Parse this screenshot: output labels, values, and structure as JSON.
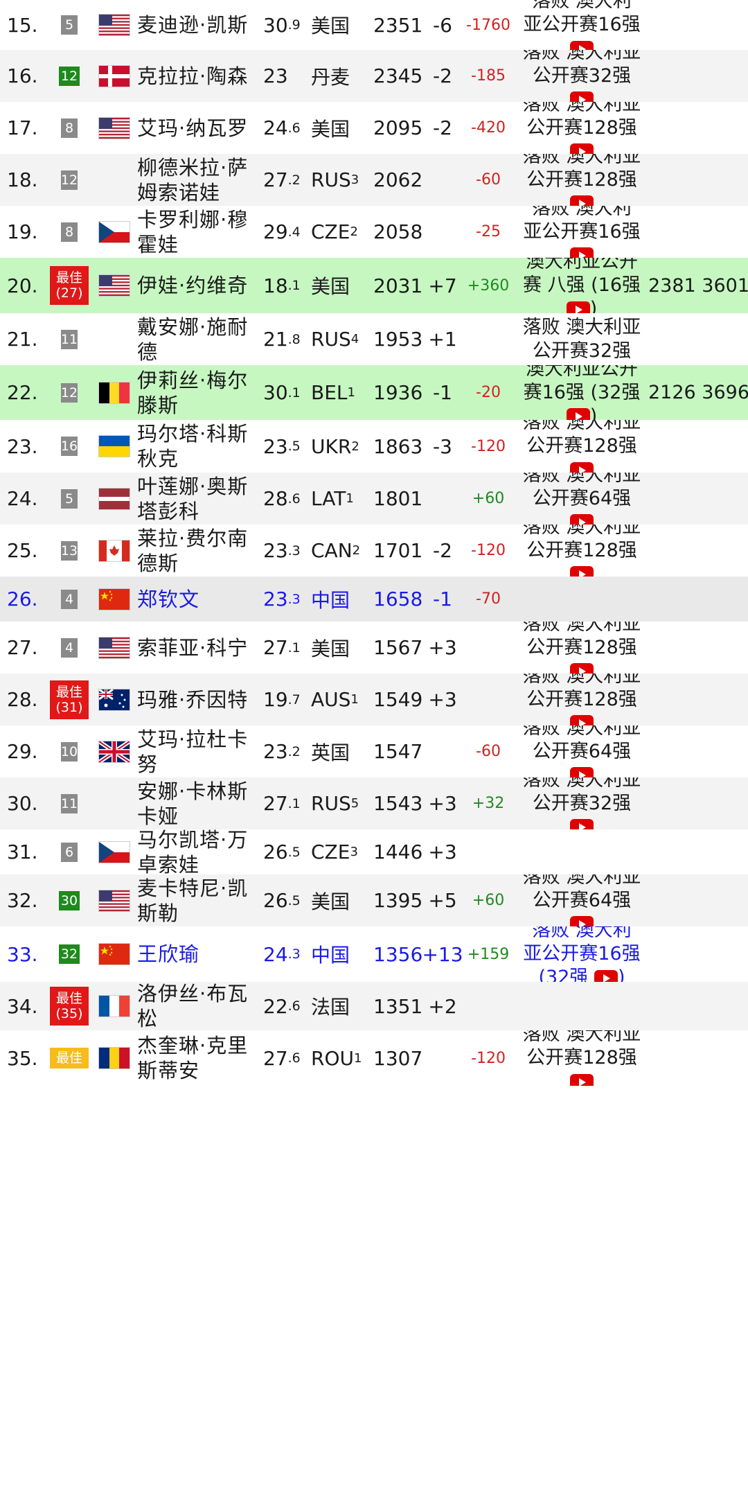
{
  "rows": [
    {
      "rank": "15.",
      "badge": "5",
      "badge_type": "gray",
      "flag": "us",
      "name": "麦迪逊·凯斯",
      "age": "30",
      "age_dec": ".9",
      "country": "美国",
      "country_sub": "",
      "points": "2351",
      "move": "-6",
      "delta": "-1760",
      "delta_type": "neg",
      "result": [
        "落败 澳大利",
        "亚公开赛16强"
      ],
      "yt": true,
      "extra": "",
      "bg": "white"
    },
    {
      "rank": "16.",
      "badge": "12",
      "badge_type": "green",
      "flag": "dk",
      "name": "克拉拉·陶森",
      "age": "23",
      "age_dec": "",
      "country": "丹麦",
      "country_sub": "",
      "points": "2345",
      "move": "-2",
      "delta": "-185",
      "delta_type": "neg",
      "result": [
        "落败 澳大利亚",
        "公开赛32强"
      ],
      "yt": true,
      "extra": "",
      "bg": "gray"
    },
    {
      "rank": "17.",
      "badge": "8",
      "badge_type": "gray",
      "flag": "us",
      "name": "艾玛·纳瓦罗",
      "age": "24",
      "age_dec": ".6",
      "country": "美国",
      "country_sub": "",
      "points": "2095",
      "move": "-2",
      "delta": "-420",
      "delta_type": "neg",
      "result": [
        "落败 澳大利亚",
        "公开赛128强"
      ],
      "yt": true,
      "extra": "",
      "bg": "white"
    },
    {
      "rank": "18.",
      "badge": "12",
      "badge_type": "gray",
      "flag": "",
      "name": "柳德米拉·萨姆索诺娃",
      "age": "27",
      "age_dec": ".2",
      "country": "RUS",
      "country_sub": "3",
      "points": "2062",
      "move": "",
      "delta": "-60",
      "delta_type": "neg",
      "result": [
        "落败 澳大利亚",
        "公开赛128强"
      ],
      "yt": true,
      "extra": "",
      "bg": "gray"
    },
    {
      "rank": "19.",
      "badge": "8",
      "badge_type": "gray",
      "flag": "cz",
      "name": "卡罗利娜·穆霍娃",
      "age": "29",
      "age_dec": ".4",
      "country": "CZE",
      "country_sub": "2",
      "points": "2058",
      "move": "",
      "delta": "-25",
      "delta_type": "neg",
      "result": [
        "落败 澳大利",
        "亚公开赛16强"
      ],
      "yt": true,
      "extra": "",
      "bg": "white"
    },
    {
      "rank": "20.",
      "badge": "最佳\n(27)",
      "badge_type": "red",
      "flag": "us",
      "name": "伊娃·约维奇",
      "age": "18",
      "age_dec": ".1",
      "country": "美国",
      "country_sub": "",
      "points": "2031",
      "move": "+7",
      "delta": "+360",
      "delta_type": "pos",
      "result": [
        "澳大利亚公开",
        "赛 八强 (16强",
        ")"
      ],
      "yt": true,
      "extra": "2381 3601",
      "bg": "green"
    },
    {
      "rank": "21.",
      "badge": "11",
      "badge_type": "gray",
      "flag": "",
      "name": "戴安娜·施耐德",
      "age": "21",
      "age_dec": ".8",
      "country": "RUS",
      "country_sub": "4",
      "points": "1953",
      "move": "+1",
      "delta": "",
      "delta_type": "neg",
      "result": [
        "落败 澳大利亚",
        "公开赛32强"
      ],
      "yt": false,
      "extra": "",
      "bg": "white"
    },
    {
      "rank": "22.",
      "badge": "12",
      "badge_type": "gray",
      "flag": "be",
      "name": "伊莉丝·梅尔滕斯",
      "age": "30",
      "age_dec": ".1",
      "country": "BEL",
      "country_sub": "1",
      "points": "1936",
      "move": "-1",
      "delta": "-20",
      "delta_type": "neg",
      "result": [
        "澳大利亚公开",
        "赛16强 (32强",
        ")"
      ],
      "yt": true,
      "extra": "2126 3696",
      "bg": "green"
    },
    {
      "rank": "23.",
      "badge": "16",
      "badge_type": "gray",
      "flag": "ua",
      "name": "玛尔塔·科斯秋克",
      "age": "23",
      "age_dec": ".5",
      "country": "UKR",
      "country_sub": "2",
      "points": "1863",
      "move": "-3",
      "delta": "-120",
      "delta_type": "neg",
      "result": [
        "落败 澳大利亚",
        "公开赛128强"
      ],
      "yt": true,
      "extra": "",
      "bg": "white"
    },
    {
      "rank": "24.",
      "badge": "5",
      "badge_type": "gray",
      "flag": "lv",
      "name": "叶莲娜·奥斯塔彭科",
      "age": "28",
      "age_dec": ".6",
      "country": "LAT",
      "country_sub": "1",
      "points": "1801",
      "move": "",
      "delta": "+60",
      "delta_type": "pos",
      "result": [
        "落败 澳大利亚",
        "公开赛64强"
      ],
      "yt": true,
      "extra": "",
      "bg": "gray"
    },
    {
      "rank": "25.",
      "badge": "13",
      "badge_type": "gray",
      "flag": "ca",
      "name": "莱拉·费尔南德斯",
      "age": "23",
      "age_dec": ".3",
      "country": "CAN",
      "country_sub": "2",
      "points": "1701",
      "move": "-2",
      "delta": "-120",
      "delta_type": "neg",
      "result": [
        "落败 澳大利亚",
        "公开赛128强"
      ],
      "yt": true,
      "extra": "",
      "bg": "white"
    },
    {
      "rank": "26.",
      "badge": "4",
      "badge_type": "gray",
      "flag": "cn",
      "name": "郑钦文",
      "age": "23",
      "age_dec": ".3",
      "country": "中国",
      "country_sub": "",
      "points": "1658",
      "move": "-1",
      "delta": "-70",
      "delta_type": "neg",
      "result": [],
      "yt": false,
      "extra": "",
      "bg": "gray2",
      "highlight": true
    },
    {
      "rank": "27.",
      "badge": "4",
      "badge_type": "gray",
      "flag": "us",
      "name": "索菲亚·科宁",
      "age": "27",
      "age_dec": ".1",
      "country": "美国",
      "country_sub": "",
      "points": "1567",
      "move": "+3",
      "delta": "",
      "delta_type": "neg",
      "result": [
        "落败 澳大利亚",
        "公开赛128强"
      ],
      "yt": true,
      "extra": "",
      "bg": "white"
    },
    {
      "rank": "28.",
      "badge": "最佳\n(31)",
      "badge_type": "red",
      "flag": "au",
      "name": "玛雅·乔因特",
      "age": "19",
      "age_dec": ".7",
      "country": "AUS",
      "country_sub": "1",
      "points": "1549",
      "move": "+3",
      "delta": "",
      "delta_type": "neg",
      "result": [
        "落败 澳大利亚",
        "公开赛128强"
      ],
      "yt": true,
      "extra": "",
      "bg": "gray"
    },
    {
      "rank": "29.",
      "badge": "10",
      "badge_type": "gray",
      "flag": "gb",
      "name": "艾玛·拉杜卡努",
      "age": "23",
      "age_dec": ".2",
      "country": "英国",
      "country_sub": "",
      "points": "1547",
      "move": "",
      "delta": "-60",
      "delta_type": "neg",
      "result": [
        "落败 澳大利亚",
        "公开赛64强"
      ],
      "yt": true,
      "extra": "",
      "bg": "white"
    },
    {
      "rank": "30.",
      "badge": "11",
      "badge_type": "gray",
      "flag": "",
      "name": "安娜·卡林斯卡娅",
      "age": "27",
      "age_dec": ".1",
      "country": "RUS",
      "country_sub": "5",
      "points": "1543",
      "move": "+3",
      "delta": "+32",
      "delta_type": "pos",
      "result": [
        "落败 澳大利亚",
        "公开赛32强"
      ],
      "yt": true,
      "extra": "",
      "bg": "gray"
    },
    {
      "rank": "31.",
      "badge": "6",
      "badge_type": "gray",
      "flag": "cz",
      "name": "马尔凯塔·万卓索娃",
      "age": "26",
      "age_dec": ".5",
      "country": "CZE",
      "country_sub": "3",
      "points": "1446",
      "move": "+3",
      "delta": "",
      "delta_type": "neg",
      "result": [],
      "yt": false,
      "extra": "",
      "bg": "white"
    },
    {
      "rank": "32.",
      "badge": "30",
      "badge_type": "green",
      "flag": "us",
      "name": "麦卡特尼·凯斯勒",
      "age": "26",
      "age_dec": ".5",
      "country": "美国",
      "country_sub": "",
      "points": "1395",
      "move": "+5",
      "delta": "+60",
      "delta_type": "pos",
      "result": [
        "落败 澳大利亚",
        "公开赛64强"
      ],
      "yt": true,
      "extra": "",
      "bg": "gray"
    },
    {
      "rank": "33.",
      "badge": "32",
      "badge_type": "green",
      "flag": "cn",
      "name": "王欣瑜",
      "age": "24",
      "age_dec": ".3",
      "country": "中国",
      "country_sub": "",
      "points": "1356",
      "move": "+13",
      "delta": "+159",
      "delta_type": "pos",
      "result": [
        "落败 澳大利",
        "亚公开赛16强",
        "(32强"
      ],
      "yt": true,
      "extra": "",
      "bg": "white",
      "highlight": true
    },
    {
      "rank": "34.",
      "badge": "最佳\n(35)",
      "badge_type": "red",
      "flag": "fr",
      "name": "洛伊丝·布瓦松",
      "age": "22",
      "age_dec": ".6",
      "country": "法国",
      "country_sub": "",
      "points": "1351",
      "move": "+2",
      "delta": "",
      "delta_type": "neg",
      "result": [],
      "yt": false,
      "extra": "",
      "bg": "gray"
    },
    {
      "rank": "35.",
      "badge": "最佳",
      "badge_type": "gold",
      "flag": "ro",
      "name": "杰奎琳·克里斯蒂安",
      "age": "27",
      "age_dec": ".6",
      "country": "ROU",
      "country_sub": "1",
      "points": "1307",
      "move": "",
      "delta": "-120",
      "delta_type": "neg",
      "result": [
        "落败 澳大利亚",
        "公开赛128强"
      ],
      "yt": true,
      "extra": "",
      "bg": "white"
    }
  ]
}
